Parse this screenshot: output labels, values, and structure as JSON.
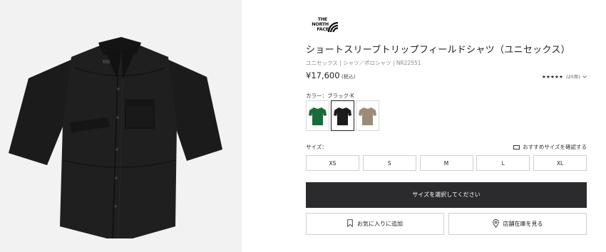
{
  "product": {
    "brand_logo_text": [
      "THE",
      "NORTH",
      "FACE"
    ],
    "title": "ショートスリーブトリップフィールドシャツ（ユニセックス）",
    "breadcrumb": "ユニセックス | シャツ／ポロシャツ | NR22551",
    "price": "¥17,600",
    "tax_note": "(税込)",
    "rating": {
      "stars": "★★★★★",
      "review_count": "(25件)",
      "chevron": "chevron-down-icon"
    }
  },
  "colors": {
    "label": "カラー：ブラック-K",
    "options": [
      {
        "name": "green",
        "hex": "#1a6b3a",
        "selected": false
      },
      {
        "name": "black",
        "hex": "#1c1c1c",
        "selected": true
      },
      {
        "name": "taupe",
        "hex": "#9a8c79",
        "selected": false
      }
    ]
  },
  "sizes": {
    "label": "サイズ：",
    "guide_link": "おすすめサイズを確認する",
    "guide_icon": "ruler-icon",
    "options": [
      "XS",
      "S",
      "M",
      "L",
      "XL"
    ]
  },
  "actions": {
    "cart_button": "サイズを選択してください",
    "favorite_button": "お気に入りに追加",
    "favorite_icon": "bookmark-icon",
    "store_button": "店舗在庫を見る",
    "store_icon": "location-pin-icon"
  },
  "palette": {
    "image_bg": "#f2f2f2",
    "shirt": "#1b1b1b",
    "primary_button": "#2b2b2e"
  }
}
